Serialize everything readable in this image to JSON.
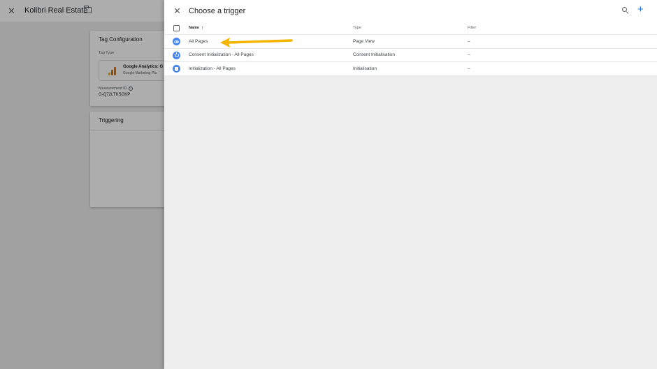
{
  "background": {
    "workspace_title": "Kolibri Real Estate",
    "tag_config": {
      "heading": "Tag Configuration",
      "tag_type_label": "Tag Type",
      "tag_name": "Google Analytics: G",
      "tag_sub": "Google Marketing Pla",
      "measurement_label": "Measurement ID",
      "measurement_value": "G-Q72LTKSGKP"
    },
    "triggering": {
      "heading": "Triggering"
    }
  },
  "panel": {
    "title": "Choose a trigger",
    "columns": {
      "name": "Name",
      "type": "Type",
      "filter": "Filter"
    },
    "rows": [
      {
        "name": "All Pages",
        "type": "Page View",
        "filter": "–",
        "icon": "eye-icon"
      },
      {
        "name": "Consent Initialization - All Pages",
        "type": "Consent Initialisation",
        "filter": "–",
        "icon": "power-icon"
      },
      {
        "name": "Initialization - All Pages",
        "type": "Initialisation",
        "filter": "–",
        "icon": "shield-icon"
      }
    ]
  },
  "colors": {
    "accent": "#1a73e8",
    "trigger_icon": "#4285f4",
    "annotation_arrow": "#f4b400",
    "ga_bars": [
      "#f9ab00",
      "#e37400",
      "#e37400"
    ]
  }
}
